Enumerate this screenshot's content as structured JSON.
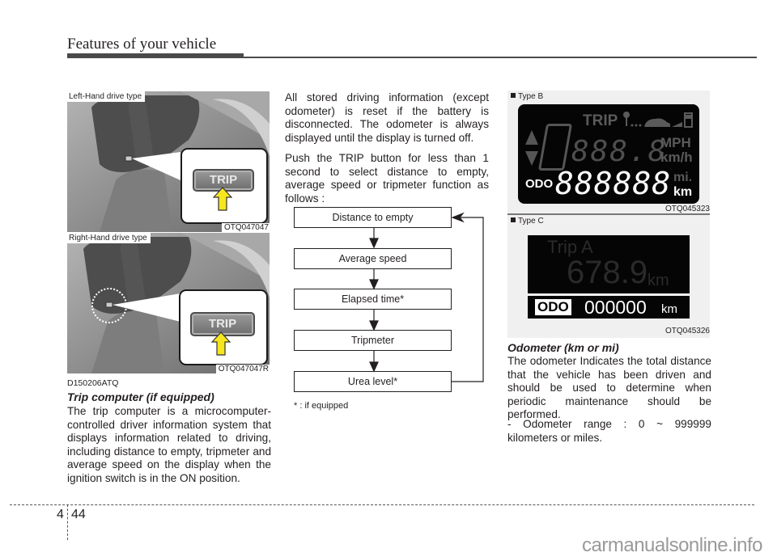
{
  "header": {
    "title": "Features of your vehicle"
  },
  "figures": {
    "lhd": {
      "label": "Left-Hand drive type",
      "code": "OTQ047047",
      "button": "TRIP"
    },
    "rhd": {
      "label": "Right-Hand drive type",
      "code": "OTQ047047R",
      "button": "TRIP"
    }
  },
  "left_column": {
    "code": "D150206ATQ",
    "section_title": "Trip computer (if equipped)",
    "paragraph": "The trip computer is a microcomputer-controlled driver information system that displays information related to driving, including distance to empty, tripmeter and average speed on the display when the ignition switch is in the ON position."
  },
  "middle_column": {
    "paragraph1": "All stored driving information (except odometer) is reset if the battery is disconnected. The odometer is always displayed until the display is turned off.",
    "paragraph2": "Push the TRIP button for less than 1 second to select distance to empty, average speed or tripmeter function as follows :",
    "flow": [
      {
        "label": "Distance to empty"
      },
      {
        "label": "Average speed"
      },
      {
        "label": "Elapsed time*"
      },
      {
        "label": "Tripmeter"
      },
      {
        "label": "Urea level*"
      }
    ],
    "footnote": "* :  if equipped"
  },
  "displays": {
    "type_b": {
      "label": "Type B",
      "code": "OTQ045323",
      "trip": "TRIP",
      "segments_small": "888.8",
      "unit_speed_1": "MPH",
      "unit_speed_2": "km/h",
      "odo": "ODO",
      "segments_large": "888888",
      "unit_dist_1": "mi.",
      "unit_dist_2": "km"
    },
    "type_c": {
      "label": "Type C",
      "code": "OTQ045326",
      "trip_name": "Trip A",
      "trip_value": "678.9",
      "trip_unit": "km",
      "odo": "ODO",
      "odo_value": "000000",
      "odo_unit": "km"
    }
  },
  "right_column": {
    "section_title": "Odometer (km or mi)",
    "paragraph": "The odometer Indicates the total distance that the vehicle has been driven and should be used to determine when periodic maintenance should be performed.",
    "bullet": "- Odometer range : 0 ~ 999999 kilometers or miles."
  },
  "footer": {
    "chapter": "4",
    "page": "44",
    "watermark": "carmanualsonline.info"
  }
}
